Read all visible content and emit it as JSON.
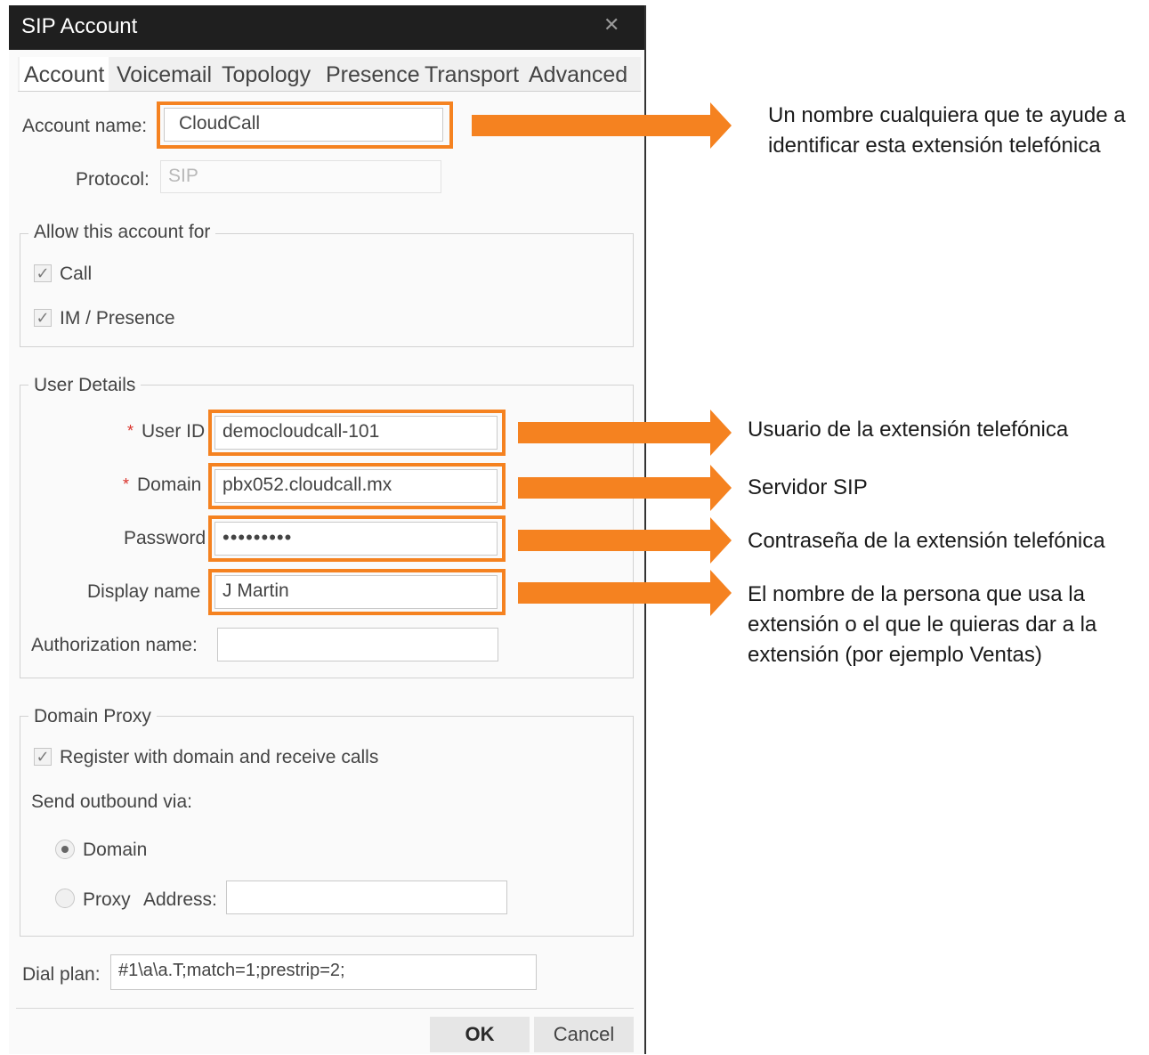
{
  "window": {
    "title": "SIP Account"
  },
  "tabs": [
    "Account",
    "Voicemail",
    "Topology",
    "Presence",
    "Transport",
    "Advanced"
  ],
  "account": {
    "name_label": "Account name:",
    "name_value": "CloudCall",
    "protocol_label": "Protocol:",
    "protocol_value": "SIP"
  },
  "allow": {
    "title": "Allow this account for",
    "call_label": "Call",
    "im_label": "IM / Presence"
  },
  "user_details": {
    "title": "User Details",
    "required_mark": "*",
    "user_id_label": "User ID",
    "user_id_value": "democloudcall-101",
    "domain_label": "Domain",
    "domain_value": "pbx052.cloudcall.mx",
    "password_label": "Password",
    "password_value": "•••••••••",
    "display_label": "Display name",
    "display_value": "J Martin",
    "auth_label": "Authorization name:",
    "auth_value": ""
  },
  "proxy": {
    "title": "Domain Proxy",
    "register_label": "Register with domain and receive calls",
    "send_label": "Send outbound via:",
    "domain_option": "Domain",
    "proxy_option": "Proxy",
    "address_label": "Address:",
    "address_value": ""
  },
  "dialplan": {
    "label": "Dial plan:",
    "value": "#1\\a\\a.T;match=1;prestrip=2;"
  },
  "buttons": {
    "ok": "OK",
    "cancel": "Cancel"
  },
  "annotations": {
    "account_name": [
      "Un nombre cualquiera que te ayude a",
      "identificar esta extensión telefónica"
    ],
    "user_id": [
      "Usuario de la extensión telefónica"
    ],
    "domain": [
      "Servidor SIP"
    ],
    "password": [
      "Contraseña de la extensión telefónica"
    ],
    "display_name": [
      "El nombre de la persona que usa la",
      "extensión o el que le quieras dar a la",
      "extensión (por ejemplo Ventas)"
    ]
  },
  "colors": {
    "highlight": "#f58220",
    "titlebar": "#1f1f1f"
  }
}
